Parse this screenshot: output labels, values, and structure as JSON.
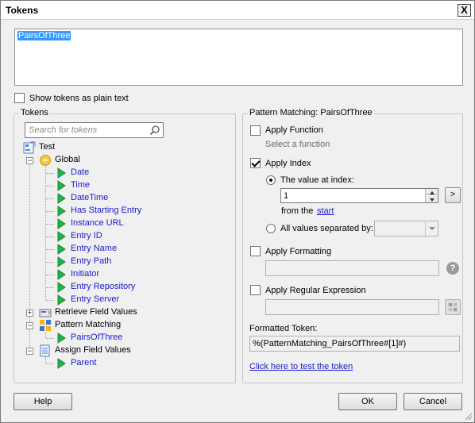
{
  "window": {
    "title": "Tokens",
    "close_glyph": "X"
  },
  "token_text": {
    "value": "PairsOfThree"
  },
  "show_plain": {
    "label": "Show tokens as plain text",
    "checked": false
  },
  "tokens_panel": {
    "legend": "Tokens",
    "search_placeholder": "Search for tokens",
    "tree": {
      "root": "Test",
      "global": "Global",
      "global_items": [
        "Date",
        "Time",
        "DateTime",
        "Has Starting Entry",
        "Instance URL",
        "Entry ID",
        "Entry Name",
        "Entry Path",
        "Initiator",
        "Entry Repository",
        "Entry Server"
      ],
      "retrieve": "Retrieve Field Values",
      "pattern": "Pattern Matching",
      "pattern_items": [
        "PairsOfThree"
      ],
      "assign": "Assign Field Values",
      "assign_items": [
        "Parent"
      ]
    }
  },
  "pattern_panel": {
    "legend": "Pattern Matching: PairsOfThree",
    "apply_function": {
      "label": "Apply Function",
      "checked": false,
      "hint": "Select a function"
    },
    "apply_index": {
      "label": "Apply Index",
      "checked": true
    },
    "value_at_index": {
      "label": "The value at index:",
      "value": "1",
      "goto": ">"
    },
    "from_the": {
      "label": "from the",
      "link": "start"
    },
    "all_values": {
      "label": "All values separated by:"
    },
    "apply_formatting": {
      "label": "Apply Formatting",
      "checked": false,
      "help": "?"
    },
    "apply_regex": {
      "label": "Apply Regular Expression",
      "checked": false
    },
    "formatted_token": {
      "label": "Formatted Token:",
      "value": "%(PatternMatching_PairsOfThree#[1]#)"
    },
    "test_link": "Click here to test the token"
  },
  "buttons": {
    "help": "Help",
    "ok": "OK",
    "cancel": "Cancel"
  },
  "colors": {
    "link": "#1a1ad0",
    "selection": "#3399ff",
    "green_arrow": "#22b14c"
  }
}
